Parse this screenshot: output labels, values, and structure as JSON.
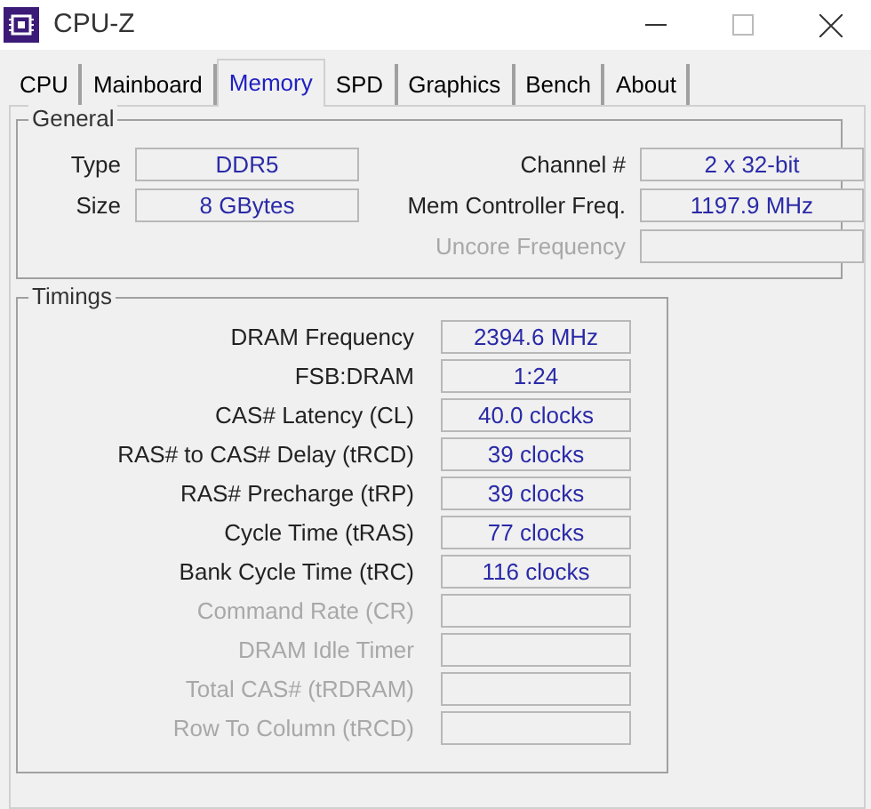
{
  "window": {
    "title": "CPU-Z"
  },
  "tabs": [
    {
      "label": "CPU",
      "selected": false
    },
    {
      "label": "Mainboard",
      "selected": false
    },
    {
      "label": "Memory",
      "selected": true
    },
    {
      "label": "SPD",
      "selected": false
    },
    {
      "label": "Graphics",
      "selected": false
    },
    {
      "label": "Bench",
      "selected": false
    },
    {
      "label": "About",
      "selected": false
    }
  ],
  "general": {
    "title": "General",
    "left": [
      {
        "label": "Type",
        "value": "DDR5"
      },
      {
        "label": "Size",
        "value": "8 GBytes"
      }
    ],
    "right": [
      {
        "label": "Channel #",
        "value": "2 x 32-bit",
        "disabled": false
      },
      {
        "label": "Mem Controller Freq.",
        "value": "1197.9 MHz",
        "disabled": false
      },
      {
        "label": "Uncore Frequency",
        "disabled": true
      }
    ]
  },
  "timings": {
    "title": "Timings",
    "rows": [
      {
        "label": "DRAM Frequency",
        "value": "2394.6 MHz",
        "disabled": false
      },
      {
        "label": "FSB:DRAM",
        "value": "1:24",
        "disabled": false
      },
      {
        "label": "CAS# Latency (CL)",
        "value": "40.0 clocks",
        "disabled": false
      },
      {
        "label": "RAS# to CAS# Delay (tRCD)",
        "value": "39 clocks",
        "disabled": false
      },
      {
        "label": "RAS# Precharge (tRP)",
        "value": "39 clocks",
        "disabled": false
      },
      {
        "label": "Cycle Time (tRAS)",
        "value": "77 clocks",
        "disabled": false
      },
      {
        "label": "Bank Cycle Time (tRC)",
        "value": "116 clocks",
        "disabled": false
      },
      {
        "label": "Command Rate (CR)",
        "disabled": true
      },
      {
        "label": "DRAM Idle Timer",
        "disabled": true
      },
      {
        "label": "Total CAS# (tRDRAM)",
        "disabled": true
      },
      {
        "label": "Row To Column (tRCD)",
        "disabled": true
      }
    ]
  }
}
